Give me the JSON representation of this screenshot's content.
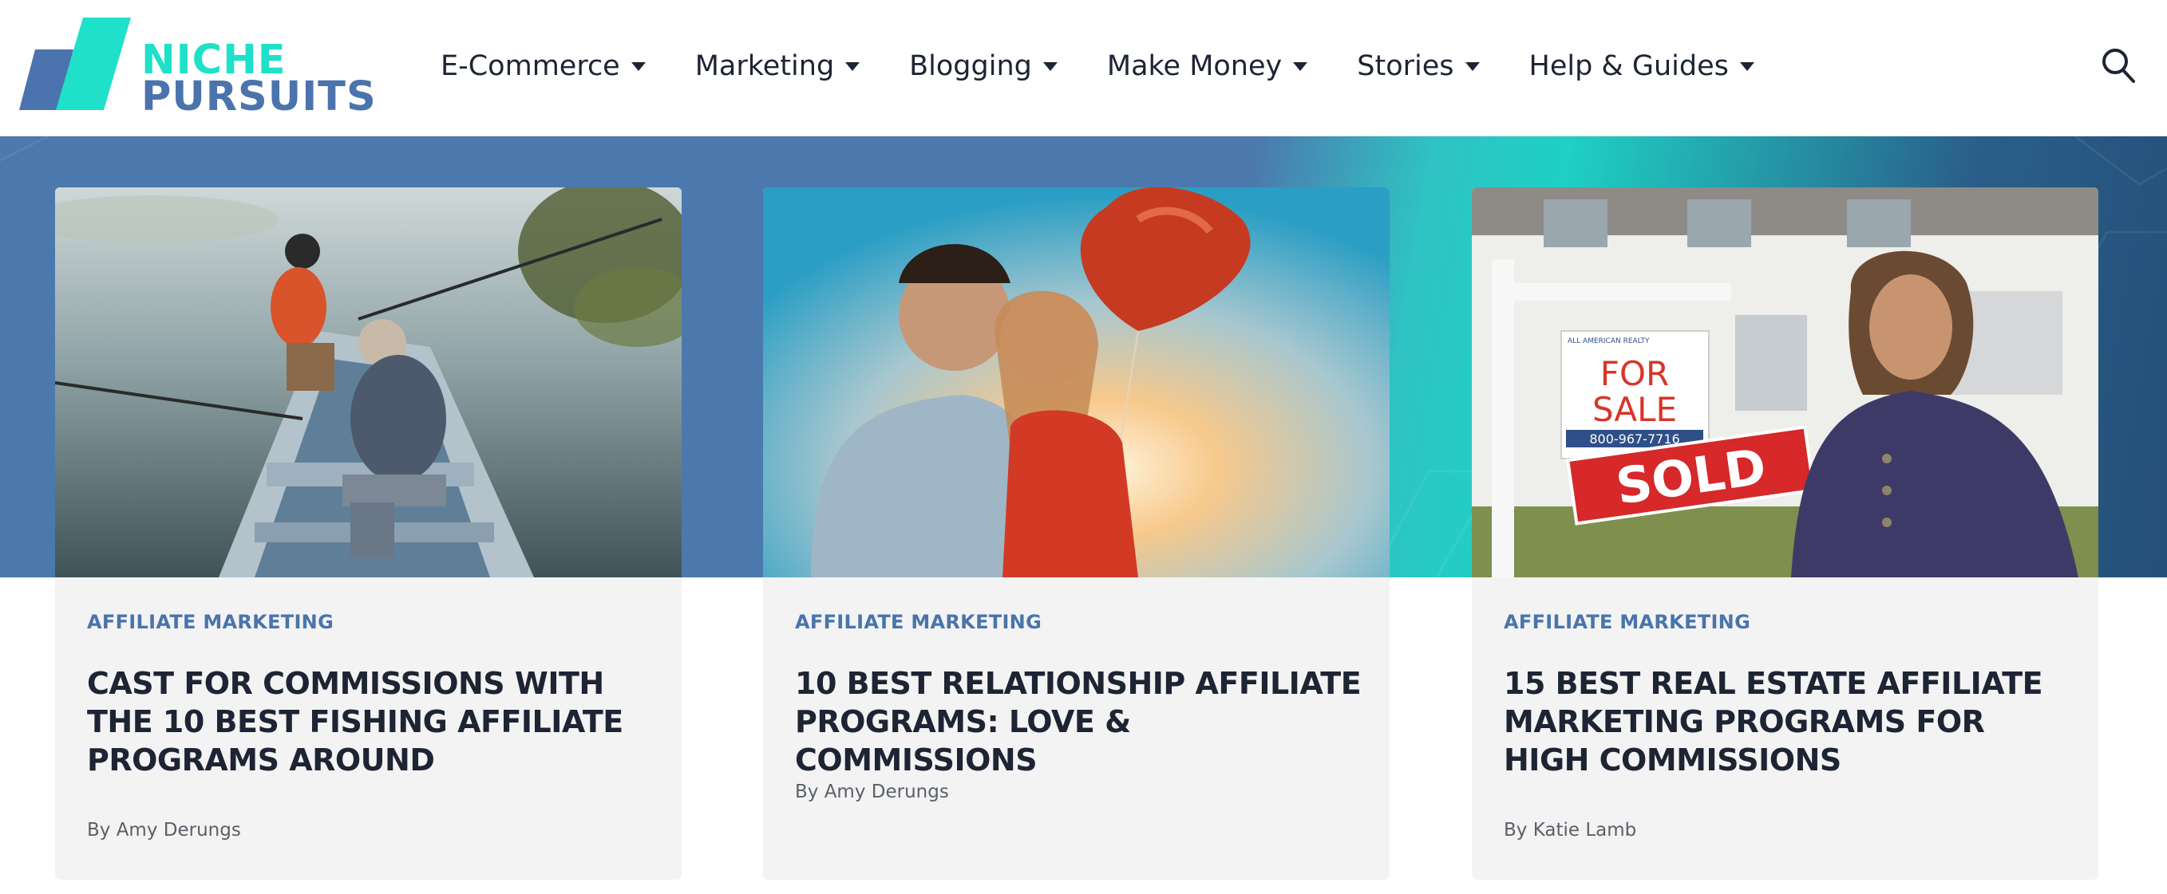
{
  "logo": {
    "line1": "NICHE",
    "line2": "PURSUITS"
  },
  "nav": {
    "items": [
      {
        "label": "E-Commerce"
      },
      {
        "label": "Marketing"
      },
      {
        "label": "Blogging"
      },
      {
        "label": "Make Money"
      },
      {
        "label": "Stories"
      },
      {
        "label": "Help & Guides"
      }
    ],
    "search_icon": "search-icon"
  },
  "colors": {
    "brand_teal": "#1fe0c8",
    "brand_blue": "#4b73ad",
    "category": "#4a74ab",
    "title": "#1d2433",
    "card_bg": "#f3f3f3"
  },
  "cards": [
    {
      "category": "AFFILIATE MARKETING",
      "title": "CAST FOR COMMISSIONS WITH THE 10 BEST FISHING AFFILIATE PROGRAMS AROUND",
      "author": "By Amy Derungs",
      "image": "father and son fishing from a rowboat on a lake"
    },
    {
      "category": "AFFILIATE MARKETING",
      "title": "10 BEST RELATIONSHIP AFFILIATE PROGRAMS: LOVE & COMMISSIONS",
      "author": "By Amy Derungs",
      "image": "couple kissing holding a red heart balloon at sunset"
    },
    {
      "category": "AFFILIATE MARKETING",
      "title": "15 BEST REAL ESTATE AFFILIATE MARKETING PROGRAMS FOR HIGH COMMISSIONS",
      "author": "By Katie Lamb",
      "image": "realtor holding a sold sign in front of a house",
      "sign_text": {
        "line1": "FOR",
        "line2": "SALE",
        "phone": "800-967-7716",
        "sold": "SOLD",
        "realty": "ALL AMERICAN REALTY"
      }
    }
  ]
}
